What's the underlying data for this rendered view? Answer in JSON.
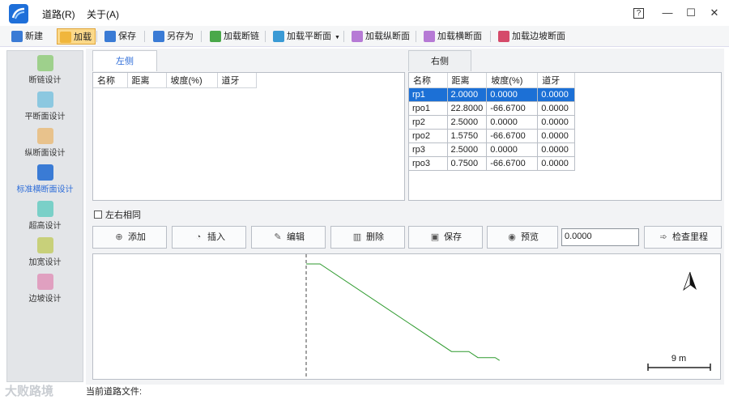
{
  "window": {
    "menus": [
      "道路(R)",
      "关于(A)"
    ],
    "controls": {
      "help": "?",
      "minimize": "—",
      "maximize": "☐",
      "close": "✕"
    }
  },
  "toolbar": {
    "items": [
      {
        "label": "新建",
        "icon": "new-file-icon",
        "color": "#3a7bd5"
      },
      {
        "label": "加载",
        "icon": "folder-open-icon",
        "color": "#f0b63c",
        "active": true
      },
      {
        "label": "保存",
        "icon": "save-icon",
        "color": "#3a7bd5"
      },
      {
        "label": "另存为",
        "icon": "save-as-icon",
        "color": "#3a7bd5"
      },
      {
        "label": "加载断链",
        "icon": "chain-icon",
        "color": "#4aa84a"
      },
      {
        "label": "加载平断面",
        "icon": "plan-icon",
        "color": "#3a9ad5"
      },
      {
        "label": "加载纵断面",
        "icon": "profile-icon",
        "color": "#b67ad5"
      },
      {
        "label": "加载横断面",
        "icon": "cross-section-icon",
        "color": "#b67ad5"
      },
      {
        "label": "加载边坡断面",
        "icon": "slope-icon",
        "color": "#d54a6a"
      }
    ]
  },
  "sidebar": {
    "items": [
      {
        "label": "断链设计",
        "icon": "chain-design-icon",
        "color": "#9ed08c"
      },
      {
        "label": "平断面设计",
        "icon": "plan-design-icon",
        "color": "#8cc8e0"
      },
      {
        "label": "纵断面设计",
        "icon": "profile-design-icon",
        "color": "#e8c28c"
      },
      {
        "label": "标准横断面设计",
        "icon": "cross-section-design-icon",
        "color": "#3a7bd5",
        "active": true
      },
      {
        "label": "超高设计",
        "icon": "superelevation-icon",
        "color": "#7ad0c8"
      },
      {
        "label": "加宽设计",
        "icon": "widening-icon",
        "color": "#c8d07a"
      },
      {
        "label": "边坡设计",
        "icon": "slope-design-icon",
        "color": "#e0a0c0"
      }
    ]
  },
  "tabs": {
    "left": "左侧",
    "right": "右侧"
  },
  "columns": [
    "名称",
    "距离",
    "坡度(%)",
    "道牙"
  ],
  "left_rows": [],
  "right_rows": [
    [
      "rp1",
      "2.0000",
      "0.0000",
      "0.0000"
    ],
    [
      "rpo1",
      "22.8000",
      "-66.6700",
      "0.0000"
    ],
    [
      "rp2",
      "2.5000",
      "0.0000",
      "0.0000"
    ],
    [
      "rpo2",
      "1.5750",
      "-66.6700",
      "0.0000"
    ],
    [
      "rp3",
      "2.5000",
      "0.0000",
      "0.0000"
    ],
    [
      "rpo3",
      "0.7500",
      "-66.6700",
      "0.0000"
    ]
  ],
  "selected_row": 0,
  "same_both_sides": "左右相同",
  "actions": {
    "add": "添加",
    "insert": "插入",
    "edit": "编辑",
    "delete": "删除",
    "save": "保存",
    "preview": "预览",
    "value": "0.0000",
    "check": "检查里程"
  },
  "preview": {
    "scale_label": "9 m",
    "north_icon": "north-arrow-icon",
    "line_color": "#2e9a2e"
  },
  "status": {
    "current_file_label": "当前道路文件:"
  },
  "watermark": "大败路境"
}
